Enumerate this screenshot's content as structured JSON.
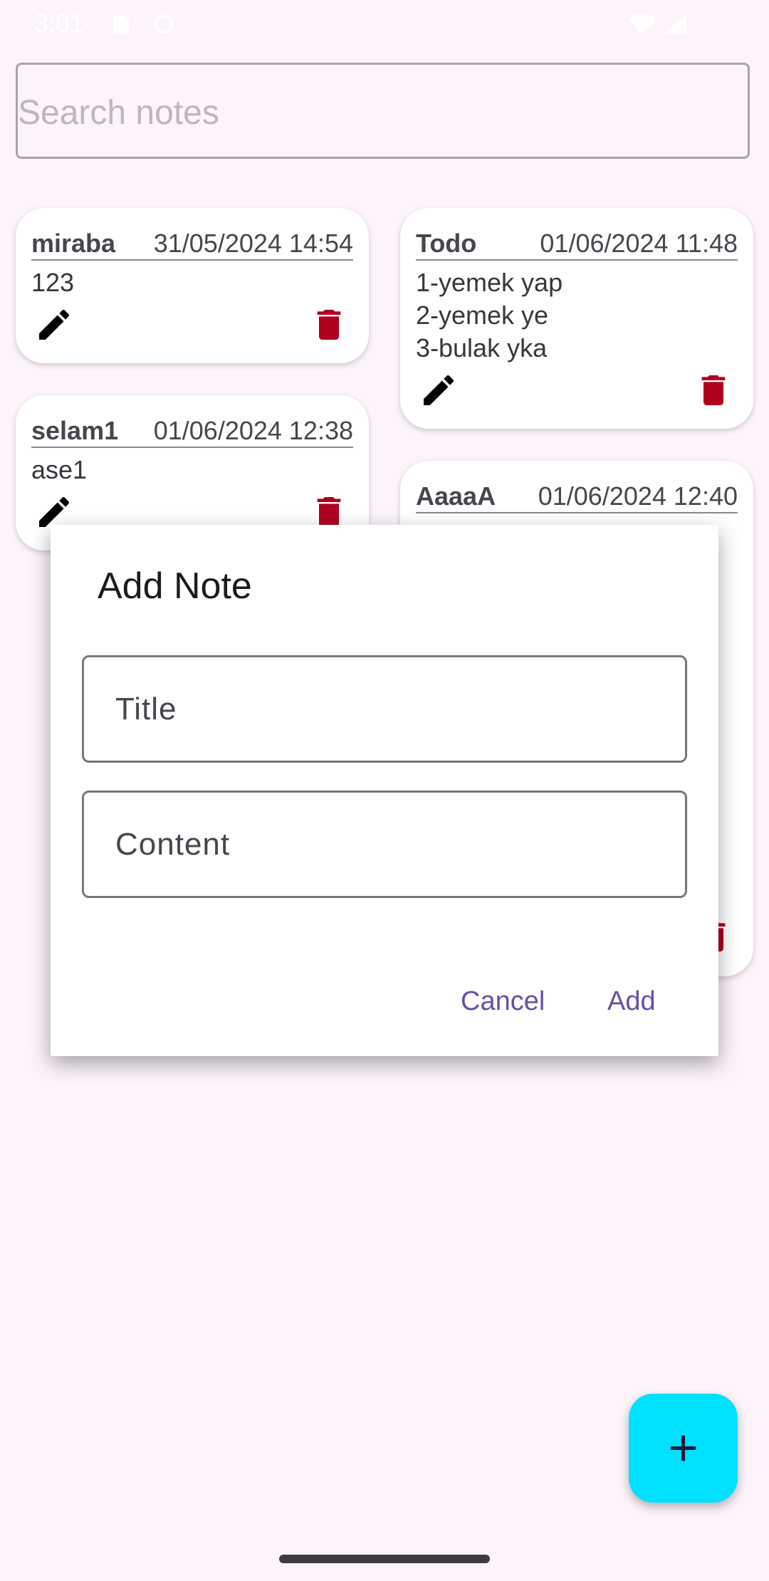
{
  "status_bar": {
    "time": "3:01"
  },
  "search": {
    "placeholder": "Search notes"
  },
  "notes": [
    {
      "title": "miraba",
      "date": "31/05/2024 14:54",
      "content": "123"
    },
    {
      "title": "Todo",
      "date": "01/06/2024 11:48",
      "content": "1-yemek yap\n2-yemek ye\n3-bulak yka"
    },
    {
      "title": "selam1",
      "date": "01/06/2024 12:38",
      "content": "ase1"
    },
    {
      "title": "AaaaA",
      "date": "01/06/2024 12:40",
      "content": ""
    }
  ],
  "dialog": {
    "title": "Add Note",
    "title_field_label": "Title",
    "content_field_label": "Content",
    "cancel_label": "Cancel",
    "add_label": "Add"
  },
  "colors": {
    "background": "#fcf3fb",
    "delete_icon": "#b00020",
    "fab": "#00e0ff",
    "dialog_button": "#6750a4"
  },
  "icons": {
    "edit": "pencil-icon",
    "delete": "trash-icon",
    "fab": "plus-icon"
  }
}
